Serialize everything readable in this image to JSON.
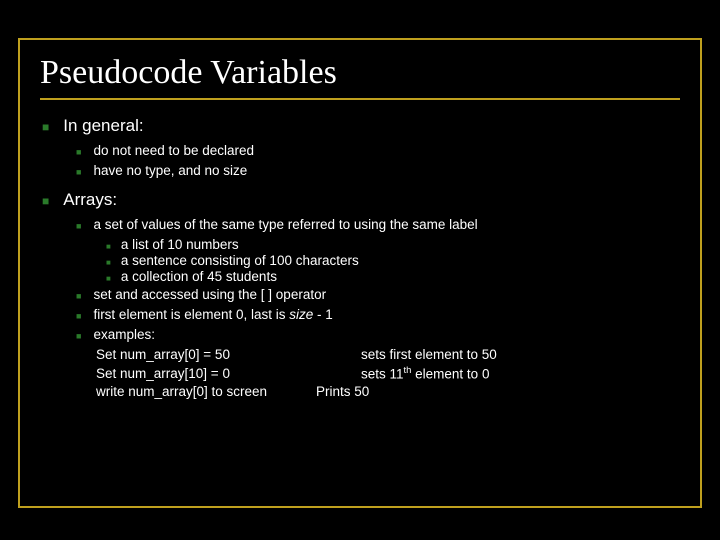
{
  "title": "Pseudocode Variables",
  "sections": [
    {
      "label": "In general:",
      "items": [
        {
          "text": "do not need to be declared"
        },
        {
          "text": "have no type, and no size"
        }
      ]
    },
    {
      "label": "Arrays:",
      "items": [
        {
          "text": "a set of values of the same type referred to using the same label",
          "sub": [
            "a list of 10 numbers",
            "a sentence consisting of 100 characters",
            "a collection of 45 students"
          ]
        },
        {
          "text": "set and accessed using the [ ] operator"
        },
        {
          "text_html": "first element is element 0, last is <span class=\"italic\">size</span> - 1"
        },
        {
          "text": "examples:",
          "examples": [
            {
              "left": "Set num_array[0] = 50",
              "right": "sets first element to 50"
            },
            {
              "left": "Set num_array[10] = 0",
              "right_html": "sets 11<sup>th</sup> element to 0"
            },
            {
              "left": "write num_array[0] to screen",
              "right": "Prints 50",
              "tight": true
            }
          ]
        }
      ]
    }
  ]
}
